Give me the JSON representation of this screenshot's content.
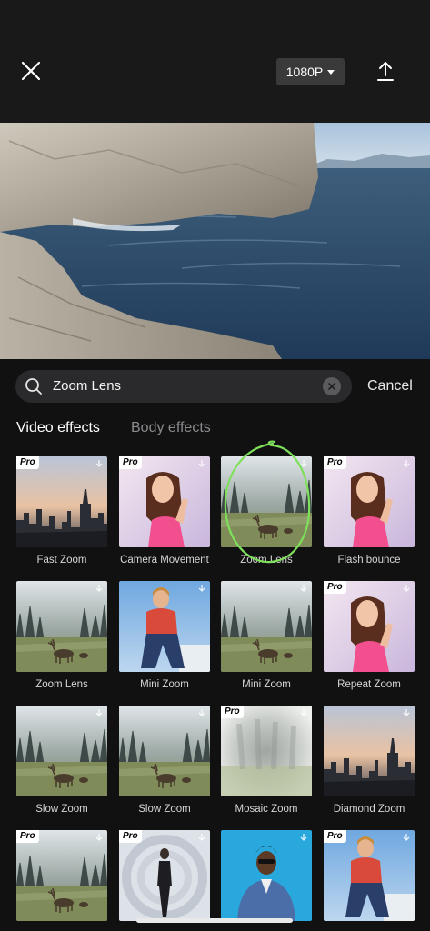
{
  "header": {
    "close_icon": "close-icon",
    "resolution": "1080P",
    "upload_icon": "upload-icon"
  },
  "search": {
    "value": "Zoom Lens",
    "cancel_label": "Cancel"
  },
  "tabs": [
    {
      "label": "Video effects",
      "active": true
    },
    {
      "label": "Body effects",
      "active": false
    }
  ],
  "effects": [
    {
      "label": "Fast Zoom",
      "pro": true,
      "thumb": "city-dusk"
    },
    {
      "label": "Camera Movement",
      "pro": true,
      "thumb": "woman-pink"
    },
    {
      "label": "Zoom Lens",
      "pro": false,
      "thumb": "deer-field",
      "highlighted": true
    },
    {
      "label": "Flash bounce",
      "pro": true,
      "thumb": "woman-pink"
    },
    {
      "label": "Zoom Lens",
      "pro": false,
      "thumb": "deer-field"
    },
    {
      "label": "Mini Zoom",
      "pro": false,
      "thumb": "man-red"
    },
    {
      "label": "Mini Zoom",
      "pro": false,
      "thumb": "deer-field"
    },
    {
      "label": "Repeat Zoom",
      "pro": true,
      "thumb": "woman-pink"
    },
    {
      "label": "Slow Zoom",
      "pro": false,
      "thumb": "deer-field"
    },
    {
      "label": "Slow Zoom",
      "pro": false,
      "thumb": "deer-field"
    },
    {
      "label": "Mosaic Zoom",
      "pro": true,
      "thumb": "blur"
    },
    {
      "label": "Diamond Zoom",
      "pro": false,
      "thumb": "city-dusk"
    },
    {
      "label": "",
      "pro": true,
      "thumb": "deer-field"
    },
    {
      "label": "",
      "pro": true,
      "thumb": "swirl"
    },
    {
      "label": "",
      "pro": false,
      "thumb": "man-blue"
    },
    {
      "label": "",
      "pro": true,
      "thumb": "man-red"
    }
  ],
  "badges": {
    "pro": "Pro"
  },
  "colors": {
    "highlight": "#7ee05a",
    "panel_bg": "#111112",
    "search_bg": "#2a2a2c"
  }
}
